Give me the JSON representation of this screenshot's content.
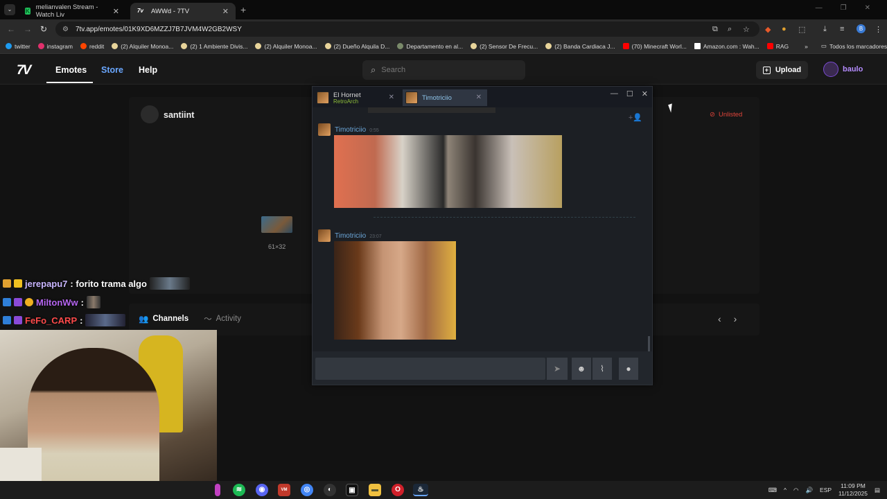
{
  "browser": {
    "tabs": [
      {
        "title": "melianvalen Stream - Watch Liv"
      },
      {
        "title": "AWWd - 7TV"
      }
    ],
    "url": "7tv.app/emotes/01K9XD6MZZJ7B7JVM4W2GB2WSY",
    "bookmarks": [
      {
        "label": "twitter",
        "color": "#1d9bf0"
      },
      {
        "label": "instagram",
        "color": "#e1306c"
      },
      {
        "label": "reddit",
        "color": "#ff4500"
      },
      {
        "label": "(2) Alquiler Monoa...",
        "color": "#e8d49a"
      },
      {
        "label": "(2) 1 Ambiente Divis...",
        "color": "#e8d49a"
      },
      {
        "label": "(2) Alquiler Monoa...",
        "color": "#e8d49a"
      },
      {
        "label": "(2) Dueño Alquila D...",
        "color": "#e8d49a"
      },
      {
        "label": "Departamento en al...",
        "color": "#7a8a6a"
      },
      {
        "label": "(2) Sensor De Frecu...",
        "color": "#e8d49a"
      },
      {
        "label": "(2) Banda Cardiaca J...",
        "color": "#e8d49a"
      },
      {
        "label": "(70) Minecraft Worl...",
        "color": "#ff0000"
      },
      {
        "label": "Amazon.com : Wah...",
        "color": "#ffffff"
      },
      {
        "label": "RAG",
        "color": "#ff0000"
      }
    ],
    "all_bookmarks": "Todos los marcadores"
  },
  "site": {
    "nav": {
      "emotes": "Emotes",
      "store": "Store",
      "help": "Help"
    },
    "search_placeholder": "Search",
    "upload": "Upload",
    "username": "baulo"
  },
  "emote_page": {
    "author": "santiint",
    "visibility": "Unlisted",
    "size_label": "61×32",
    "tabs": {
      "channels": "Channels",
      "activity": "Activity"
    }
  },
  "stream_chat": [
    {
      "user": "jerepapu7",
      "message": ": forito trama algo",
      "color": "#c9b6ff"
    },
    {
      "user": "MiltonWw",
      "message": ":",
      "color": "#b565f0"
    },
    {
      "user": "FeFo_CARP",
      "message": ":",
      "color": "#ff4a4a"
    }
  ],
  "steam_chat": {
    "tabs": [
      {
        "name": "El Hornet",
        "sub": "RetroArch"
      },
      {
        "name": "Timotriciio"
      }
    ],
    "messages": [
      {
        "user": "Timotriciio",
        "time": "0:55"
      },
      {
        "user": "Timotriciio",
        "time": "23:07"
      }
    ]
  },
  "tray": {
    "lang": "ESP",
    "time": "11:09 PM",
    "date": "11/12/2025"
  }
}
